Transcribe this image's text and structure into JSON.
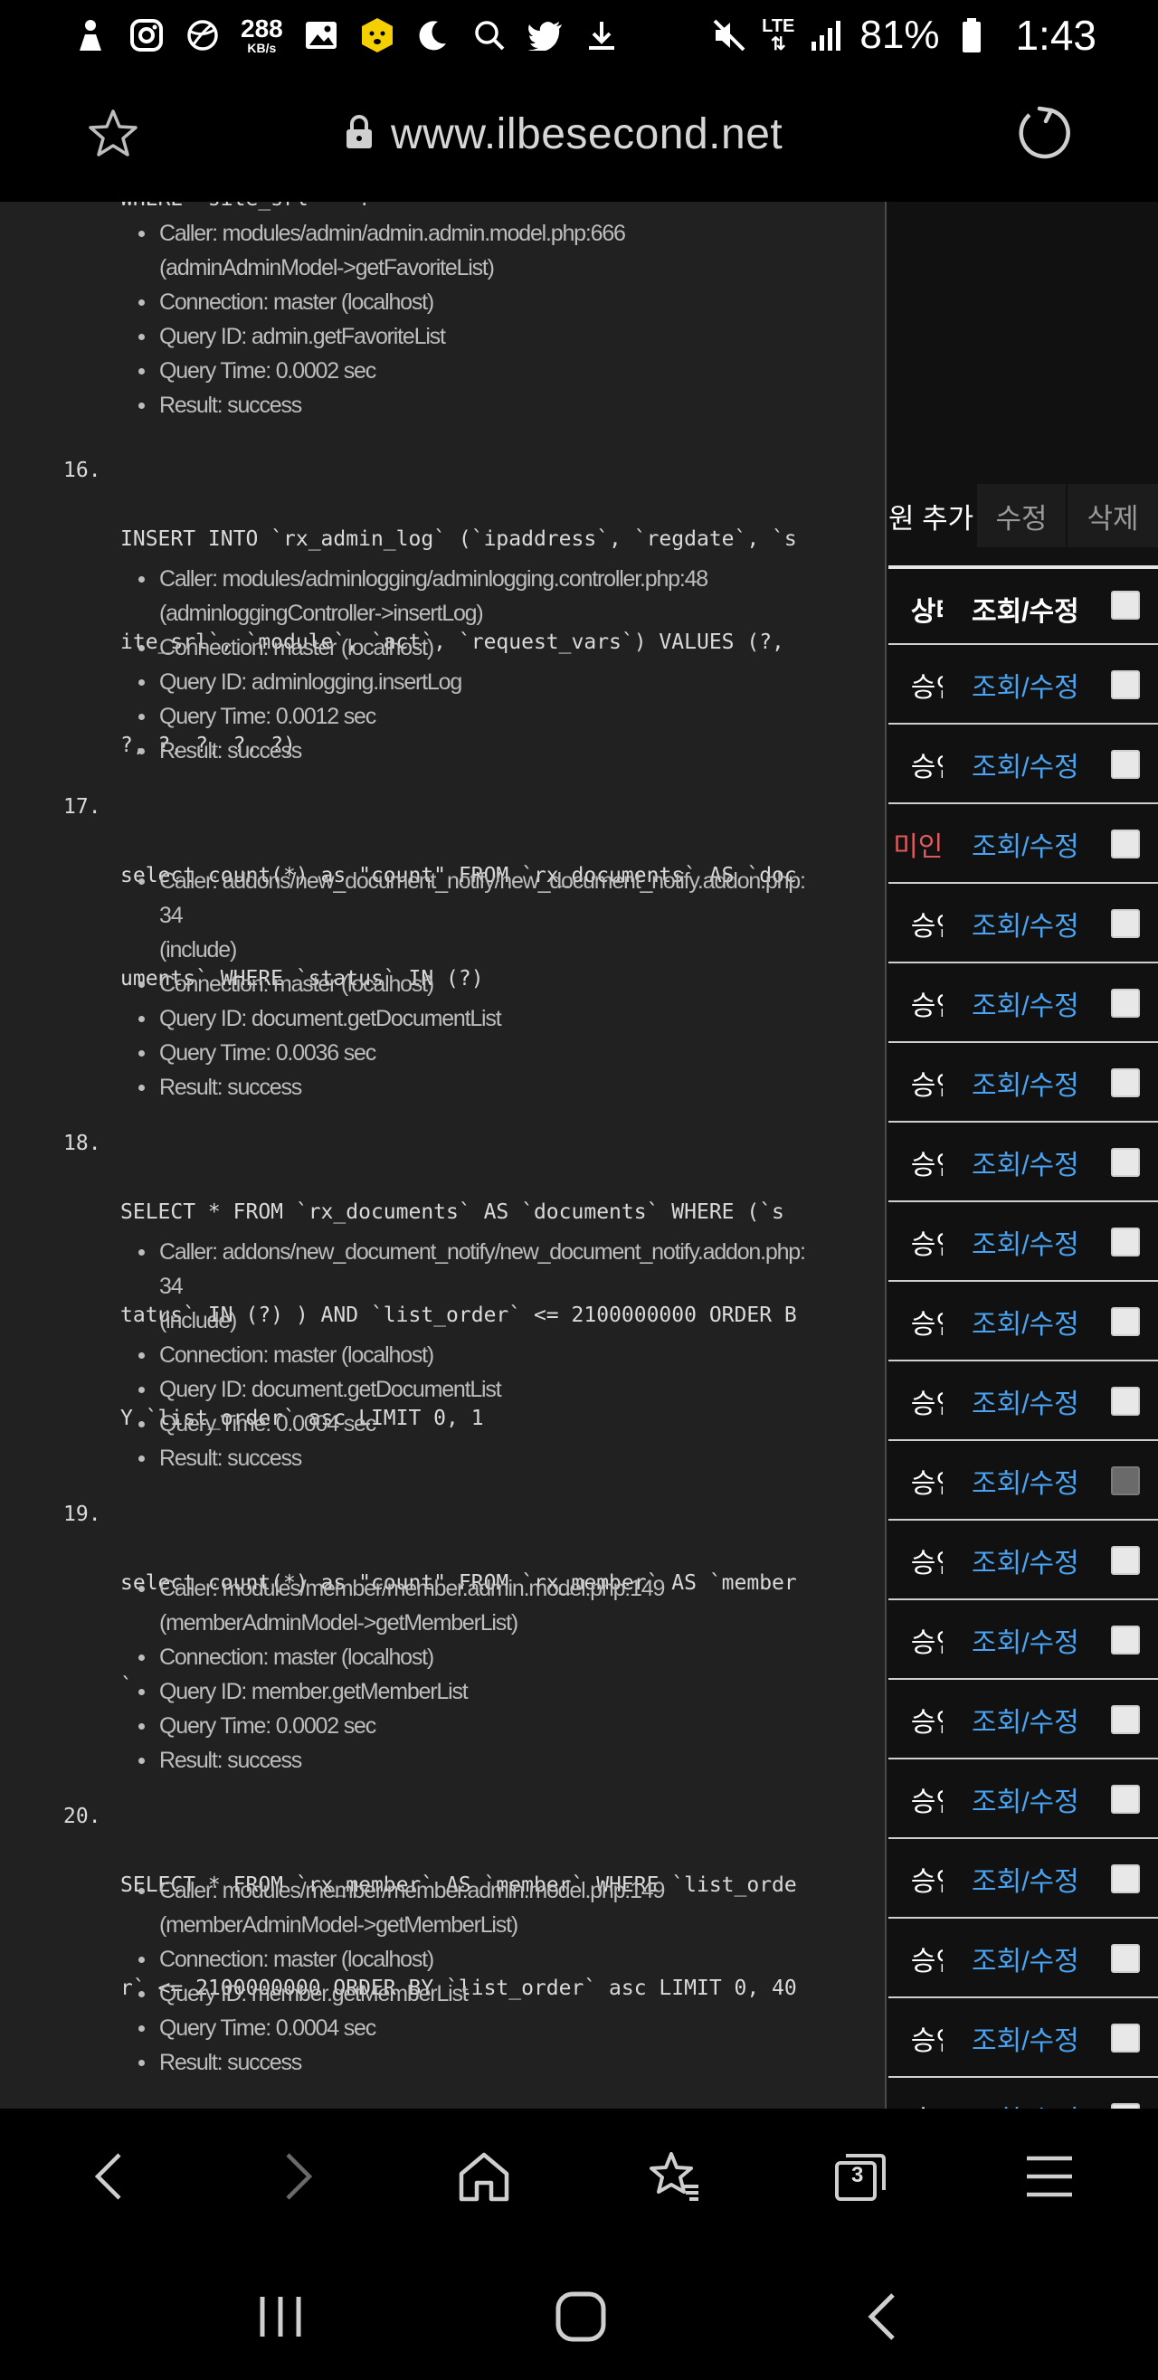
{
  "status_bar": {
    "speed_value": "288",
    "speed_unit": "KB/s",
    "network": "LTE",
    "battery": "81%",
    "time": "1:43",
    "icons": [
      "person-icon",
      "instagram-icon",
      "basketball-icon",
      "image-icon",
      "emoji-icon",
      "moon-icon",
      "search-icon",
      "twitter-icon",
      "download-icon",
      "mute-icon",
      "lte-icon",
      "signal-icon",
      "battery-icon"
    ]
  },
  "browser": {
    "url": "www.ilbesecond.net",
    "tabs_count": "3"
  },
  "debug": {
    "partial_top_sql": "WHERE `site_srl` = ?",
    "partial_top_details": [
      "Caller: modules/admin/admin.admin.model.php:666",
      "(adminAdminModel->getFavoriteList)",
      "Connection: master (localhost)",
      "Query ID: admin.getFavoriteList",
      "Query Time: 0.0002 sec",
      "Result: success"
    ],
    "queries": [
      {
        "num": "16.",
        "sql": "INSERT INTO `rx_admin_log` (`ipaddress`, `regdate`, `site_srl`, `module`, `act`, `request_vars`) VALUES (?, ?, ?, ?, ?, ?)",
        "sql_lines": [
          "INSERT INTO `rx_admin_log` (`ipaddress`, `regdate`, `s",
          "ite_srl`, `module`, `act`, `request_vars`) VALUES (?,",
          "?, ?, ?, ?, ?)"
        ],
        "caller": "Caller: modules/adminlogging/adminlogging.controller.php:48",
        "caller_cont": [
          "(adminloggingController->insertLog)"
        ],
        "connection": "Connection: master (localhost)",
        "query_id": "Query ID: adminlogging.insertLog",
        "query_time": "Query Time: 0.0012 sec",
        "result": "Result: success"
      },
      {
        "num": "17.",
        "sql_lines": [
          "select count(*) as \"count\" FROM `rx_documents` AS `doc",
          "uments` WHERE `status` IN (?)"
        ],
        "caller": "Caller: addons/new_document_notify/new_document_notify.addon.php:",
        "caller_cont": [
          "34",
          "(include)"
        ],
        "connection": "Connection: master (localhost)",
        "query_id": "Query ID: document.getDocumentList",
        "query_time": "Query Time: 0.0036 sec",
        "result": "Result: success"
      },
      {
        "num": "18.",
        "sql_lines": [
          "SELECT * FROM `rx_documents` AS `documents` WHERE (`s",
          "tatus` IN (?) ) AND `list_order` <= 2100000000 ORDER B",
          "Y `list_order` asc LIMIT 0, 1"
        ],
        "caller": "Caller: addons/new_document_notify/new_document_notify.addon.php:",
        "caller_cont": [
          "34",
          "(include)"
        ],
        "connection": "Connection: master (localhost)",
        "query_id": "Query ID: document.getDocumentList",
        "query_time": "Query Time: 0.0004 sec",
        "result": "Result: success"
      },
      {
        "num": "19.",
        "sql_lines": [
          "select count(*) as \"count\" FROM `rx_member` AS `member",
          "`"
        ],
        "caller": "Caller: modules/member/member.admin.model.php:149",
        "caller_cont": [
          "(memberAdminModel->getMemberList)"
        ],
        "connection": "Connection: master (localhost)",
        "query_id": "Query ID: member.getMemberList",
        "query_time": "Query Time: 0.0002 sec",
        "result": "Result: success"
      },
      {
        "num": "20.",
        "sql_lines": [
          "SELECT * FROM `rx_member` AS `member` WHERE `list_orde",
          "r` <= 2100000000 ORDER BY `list_order` asc LIMIT 0, 40"
        ],
        "caller": "Caller: modules/member/member.admin.model.php:149",
        "caller_cont": [
          "(memberAdminModel->getMemberList)"
        ],
        "connection": "Connection: master (localhost)",
        "query_id": "Query ID: member.getMemberList",
        "query_time": "Query Time: 0.0004 sec",
        "result": "Result: success"
      }
    ]
  },
  "admin_table": {
    "tabs": [
      "원 추가",
      "수정",
      "삭제"
    ],
    "header": {
      "status": "상태",
      "action": "조회/수정"
    },
    "rows": [
      {
        "status": "승인",
        "action": "조회/수정",
        "red": false,
        "checked": false
      },
      {
        "status": "승인",
        "action": "조회/수정",
        "red": false,
        "checked": false
      },
      {
        "status": "미인증",
        "action": "조회/수정",
        "red": true,
        "checked": false
      },
      {
        "status": "승인",
        "action": "조회/수정",
        "red": false,
        "checked": false
      },
      {
        "status": "승인",
        "action": "조회/수정",
        "red": false,
        "checked": false
      },
      {
        "status": "승인",
        "action": "조회/수정",
        "red": false,
        "checked": false
      },
      {
        "status": "승인",
        "action": "조회/수정",
        "red": false,
        "checked": false
      },
      {
        "status": "승인",
        "action": "조회/수정",
        "red": false,
        "checked": false
      },
      {
        "status": "승인",
        "action": "조회/수정",
        "red": false,
        "checked": false
      },
      {
        "status": "승인",
        "action": "조회/수정",
        "red": false,
        "checked": false
      },
      {
        "status": "승인",
        "action": "조회/수정",
        "red": false,
        "checked": true
      },
      {
        "status": "승인",
        "action": "조회/수정",
        "red": false,
        "checked": false
      },
      {
        "status": "승인",
        "action": "조회/수정",
        "red": false,
        "checked": false
      },
      {
        "status": "승인",
        "action": "조회/수정",
        "red": false,
        "checked": false
      },
      {
        "status": "승인",
        "action": "조회/수정",
        "red": false,
        "checked": false
      },
      {
        "status": "승인",
        "action": "조회/수정",
        "red": false,
        "checked": false
      },
      {
        "status": "승인",
        "action": "조회/수정",
        "red": false,
        "checked": false
      },
      {
        "status": "승인",
        "action": "조회/수정",
        "red": false,
        "checked": false
      },
      {
        "status": "승인",
        "action": "조회/수정",
        "red": false,
        "checked": false
      }
    ]
  },
  "colors": {
    "link": "#4aa3f0",
    "unverified": "#e05a5a",
    "panel_bg": "#212121"
  }
}
